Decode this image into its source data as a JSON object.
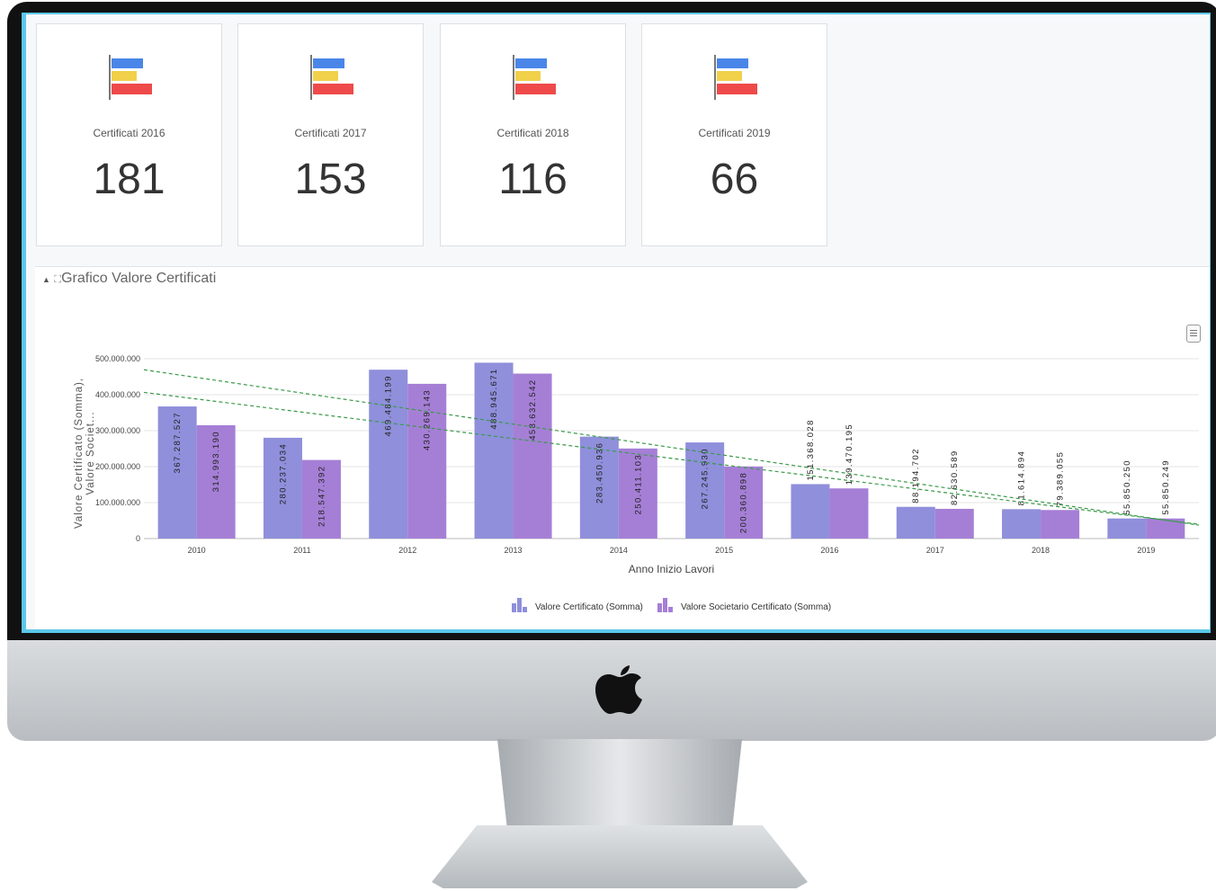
{
  "kpis": [
    {
      "label": "Certificati 2016",
      "value": "181"
    },
    {
      "label": "Certificati 2017",
      "value": "153"
    },
    {
      "label": "Certificati 2018",
      "value": "116"
    },
    {
      "label": "Certificati 2019",
      "value": "66"
    }
  ],
  "panel": {
    "title": "Grafico Valore Certificati",
    "collapse_icon": "caret-up-icon",
    "expand_icon": "fullscreen-icon",
    "menu_icon": "hamburger-menu-icon"
  },
  "colors": {
    "series1": "#8f8fdb",
    "series2": "#a57fd6",
    "trend": "#3a9a4a",
    "kpi_blue": "#4a86e8",
    "kpi_yellow": "#f1d14a",
    "kpi_red": "#ef4a4a",
    "screen_border": "#5bc8ea"
  },
  "chart_data": {
    "type": "bar",
    "categories": [
      "2010",
      "2011",
      "2012",
      "2013",
      "2014",
      "2015",
      "2016",
      "2017",
      "2018",
      "2019"
    ],
    "series": [
      {
        "name": "Valore Certificato (Somma)",
        "values": [
          367287527,
          280237034,
          469484199,
          488945671,
          283450936,
          267245930,
          151368028,
          88194702,
          81614894,
          55850250
        ],
        "labels": [
          "367.287.527",
          "280.237.034",
          "469.484.199",
          "488.945.671",
          "283.450.936",
          "267.245.930",
          "151.368.028",
          "88.194.702",
          "81.614.894",
          "55.850.250"
        ]
      },
      {
        "name": "Valore Societario Certificato (Somma)",
        "values": [
          314993190,
          218547392,
          430269143,
          458632542,
          250411103,
          200360898,
          139470195,
          82630589,
          79389055,
          55850249
        ],
        "labels": [
          "314.993.190",
          "218.547.392",
          "430.269.143",
          "458.632.542",
          "250.411.103",
          "200.360.898",
          "139.470.195",
          "82.630.589",
          "79.389.055",
          "55.850.249"
        ]
      }
    ],
    "trendlines": true,
    "xlabel": "Anno Inizio Lavori",
    "ylabel": "Valore Certificato (Somma), Valore Societ...",
    "ylim": [
      0,
      500000000
    ],
    "yticks": [
      "0",
      "100.000.000",
      "200.000.000",
      "300.000.000",
      "400.000.000",
      "500.000.000"
    ],
    "ytick_values": [
      0,
      100000000,
      200000000,
      300000000,
      400000000,
      500000000
    ],
    "legend": "bottom-center",
    "grid": true
  }
}
